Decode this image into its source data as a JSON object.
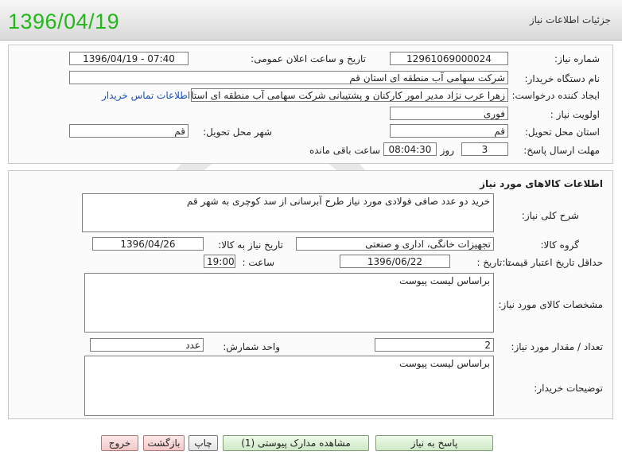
{
  "header": {
    "date": "1396/04/19",
    "title": "جزئیات اطلاعات نیاز"
  },
  "info": {
    "need_number_label": "شماره نیاز:",
    "need_number": "1296106900002​4",
    "announce_label": "تاریخ و ساعت اعلان عمومی:",
    "announce_value": "1396/04/19 - 07:40",
    "buyer_label": "نام دستگاه خریدار:",
    "buyer_value": "شرکت سهامی آب منطقه ای استان قم",
    "creator_label": "ایجاد کننده درخواست:",
    "creator_value": "زهرا عرب نژاد مدیر امور کارکنان و پشتیبانی شرکت سهامی آب منطقه ای استان",
    "contact_link": "اطلاعات تماس خریدار",
    "priority_label": "اولویت نیاز :",
    "priority_value": "فوری",
    "province_label": "استان محل تحویل:",
    "province_value": "قم",
    "city_label": "شهر محل تحویل:",
    "city_value": "قم",
    "deadline_label": "مهلت ارسال پاسخ:",
    "deadline_days": "3",
    "days_label": "روز و",
    "deadline_time": "08:04:30",
    "remaining_label": "ساعت باقی مانده"
  },
  "goods": {
    "section_title": "اطلاعات کالاهای مورد نیاز",
    "desc_label": "شرح کلی نیاز:",
    "desc_value": "خرید دو عدد صافی فولادی مورد نیاز طرح آبرسانی از سد کوچری به شهر قم",
    "group_label": "گروه کالا:",
    "group_value": "تجهیزات خانگی، اداری و صنعتی",
    "need_date_label": "تاریخ نیاز به کالا:",
    "need_date_value": "1396/04/26",
    "validity_label": "حداقل تاریخ اعتبار قیمت:",
    "until_label": "تا تاریخ :",
    "until_value": "1396/06/22",
    "time_label": "ساعت :",
    "time_value": "19:00",
    "specs_label": "مشخصات کالای مورد نیاز:",
    "specs_value": "براساس لیست پیوست",
    "qty_label": "تعداد / مقدار مورد نیاز:",
    "qty_value": "2",
    "unit_label": "واحد شمارش:",
    "unit_value": "عدد",
    "notes_label": "توضیحات خریدار:",
    "notes_value": "براساس لیست پیوست"
  },
  "buttons": {
    "reply": "پاسخ به نیاز",
    "attachments": "مشاهده مدارک پیوستی (1)",
    "print": "چاپ",
    "back": "بازگشت",
    "exit": "خروج"
  },
  "colors": {
    "date_green": "#22b81a",
    "link_blue": "#1a4fb5"
  }
}
